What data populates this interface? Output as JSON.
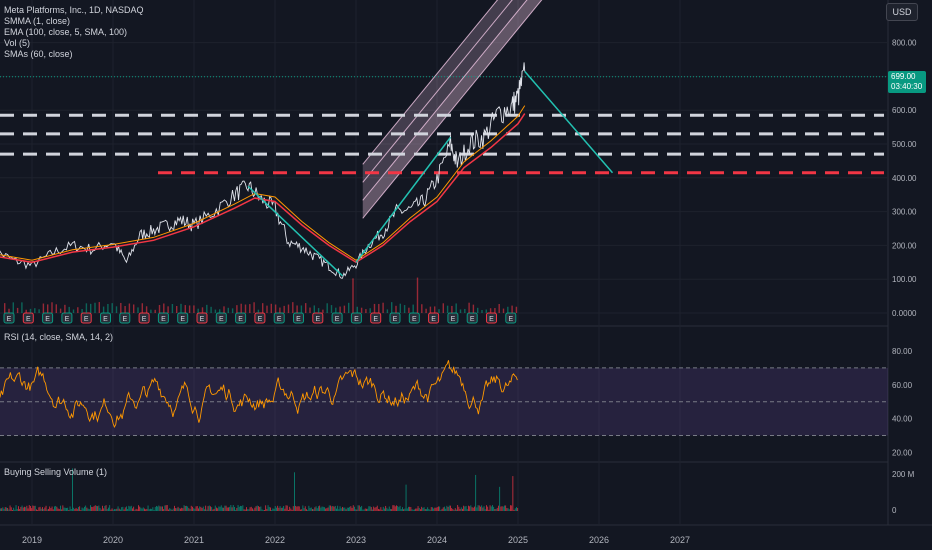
{
  "header": {
    "symbol_line": "Meta Platforms, Inc., 1D, NASDAQ",
    "indicators": [
      "SMMA (1, close)",
      "EMA (100, close, 5, SMA, 100)",
      "Vol (5)",
      "SMAs (60, close)"
    ],
    "currency": "USD"
  },
  "price_tag": {
    "price": "699.00",
    "countdown": "03:40:30",
    "color": "#089981"
  },
  "rsi_legend": "RSI (14, close, SMA, 14, 2)",
  "volume_legend": "Buying Selling Volume (1)",
  "colors": {
    "background": "#131722",
    "price_line": "#e0e3eb",
    "ema": "#f23645",
    "sma": "#ff9800",
    "trend_line": "#22c1b1",
    "channel_fill": "#f3c8e6",
    "support_white": "#d1d4dc",
    "support_red": "#f23645",
    "rsi_line": "#ff9800",
    "rsi_band": "#7e57c2",
    "earnings_badge": "#e6a2a2"
  },
  "chart_data": {
    "type": "line",
    "title": "Meta Platforms, Inc., 1D, NASDAQ",
    "price_axis_ticks": [
      "800.00",
      "700.00",
      "600.00",
      "500.00",
      "400.00",
      "300.00",
      "200.00",
      "100.00",
      "0.0000"
    ],
    "rsi_axis_ticks": [
      "80.00",
      "60.00",
      "40.00",
      "20.00"
    ],
    "volume_axis_ticks": [
      "200 M",
      "0"
    ],
    "x_ticks": [
      "2019",
      "2020",
      "2021",
      "2022",
      "2023",
      "2024",
      "2025",
      "2026",
      "2027"
    ],
    "ylim": [
      0,
      870
    ],
    "price_series": {
      "name": "META",
      "x": [
        "2018-07",
        "2018-10",
        "2019-01",
        "2019-04",
        "2019-07",
        "2019-10",
        "2020-01",
        "2020-03",
        "2020-05",
        "2020-07",
        "2020-09",
        "2020-11",
        "2021-01",
        "2021-04",
        "2021-07",
        "2021-09",
        "2021-11",
        "2022-01",
        "2022-03",
        "2022-05",
        "2022-07",
        "2022-09",
        "2022-11",
        "2023-01",
        "2023-03",
        "2023-05",
        "2023-07",
        "2023-09",
        "2023-11",
        "2024-01",
        "2024-03",
        "2024-04",
        "2024-06",
        "2024-08",
        "2024-10",
        "2024-12",
        "2025-01",
        "2025-02"
      ],
      "values": [
        190,
        158,
        140,
        178,
        200,
        188,
        210,
        150,
        230,
        245,
        260,
        275,
        260,
        300,
        350,
        375,
        335,
        310,
        210,
        195,
        165,
        138,
        110,
        145,
        205,
        240,
        300,
        305,
        330,
        395,
        500,
        440,
        505,
        520,
        590,
        610,
        640,
        715
      ]
    },
    "ema_series": {
      "name": "EMA (100, close, 5, SMA, 100)",
      "x": [
        "2018-07",
        "2019-01",
        "2019-07",
        "2020-01",
        "2020-07",
        "2021-01",
        "2021-07",
        "2021-10",
        "2022-01",
        "2022-05",
        "2022-09",
        "2023-01",
        "2023-05",
        "2023-09",
        "2024-01",
        "2024-05",
        "2024-09",
        "2025-01",
        "2025-02"
      ],
      "values": [
        170,
        150,
        180,
        195,
        215,
        255,
        310,
        340,
        330,
        260,
        200,
        150,
        200,
        270,
        330,
        430,
        490,
        560,
        590
      ]
    },
    "support_levels": [
      {
        "value": 585,
        "style": "dashed",
        "color": "white"
      },
      {
        "value": 530,
        "style": "dashed",
        "color": "white"
      },
      {
        "value": 470,
        "style": "dashed",
        "color": "white"
      },
      {
        "value": 415,
        "style": "dashed",
        "color": "red"
      }
    ],
    "projection_line": {
      "from": [
        "2025-02",
        715
      ],
      "to": [
        "2026-03",
        415
      ]
    },
    "rsi": {
      "levels": [
        70,
        50,
        30
      ],
      "ylim": [
        15,
        90
      ]
    }
  }
}
